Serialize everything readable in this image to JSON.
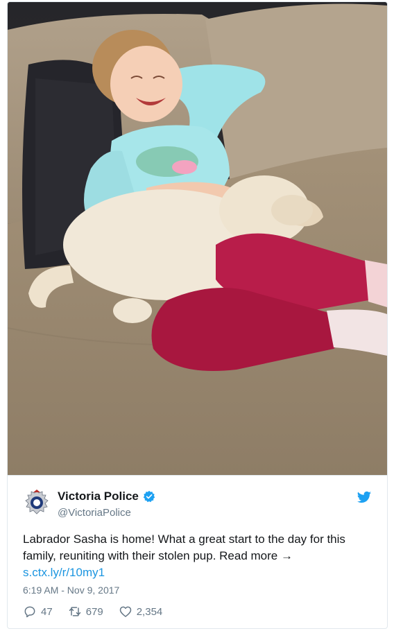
{
  "author": {
    "display_name": "Victoria Police",
    "handle": "@VictoriaPolice"
  },
  "tweet": {
    "text_lines": [
      "Labrador Sasha is home! What a great start to the day for this",
      "family, reuniting with their stolen pup. Read more →"
    ],
    "link": "s.ctx.ly/r/10my1",
    "timestamp": "6:19 AM - Nov 9, 2017"
  },
  "stats": {
    "replies": "47",
    "retweets": "679",
    "likes": "2,354"
  },
  "colors": {
    "link": "#1b95e0",
    "verified": "#1da1f2",
    "muted": "#657786"
  },
  "icons": {
    "verified": "verified-badge-icon",
    "twitter": "twitter-bird-icon",
    "reply": "reply-icon",
    "retweet": "retweet-icon",
    "like": "heart-icon"
  }
}
